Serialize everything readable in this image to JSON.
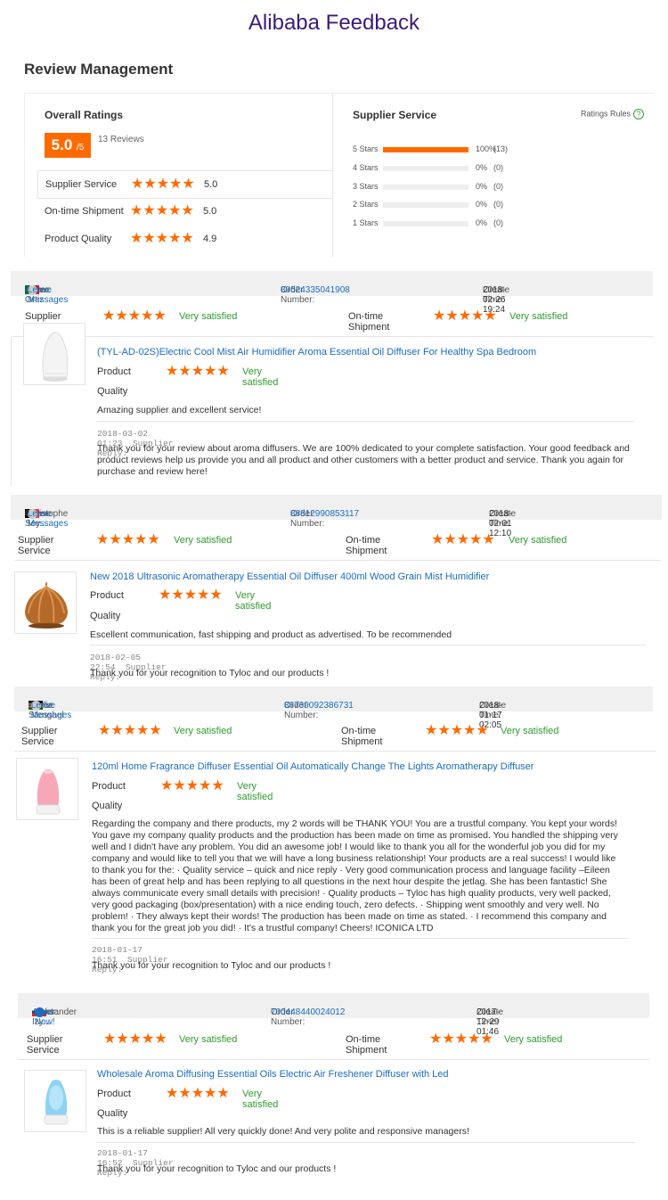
{
  "page": {
    "title": "Alibaba Feedback",
    "section_title": "Review Management"
  },
  "summary": {
    "overall_label": "Overall Ratings",
    "score": "5.0",
    "score_suffix": "/5",
    "reviews_count": "13 Reviews",
    "sub_ratings": [
      {
        "label": "Supplier Service",
        "value": "5.0",
        "stars": 5
      },
      {
        "label": "On-time Shipment",
        "value": "5.0",
        "stars": 5
      },
      {
        "label": "Product Quality",
        "value": "4.9",
        "stars": 5
      }
    ],
    "supplier_service_label": "Supplier Service",
    "rules_label": "Ratings Rules",
    "distribution": [
      {
        "label": "5 Stars",
        "fraction": 1.0,
        "pct": "100%",
        "count": "(13)"
      },
      {
        "label": "4 Stars",
        "fraction": 0,
        "pct": "0%",
        "count": "(0)"
      },
      {
        "label": "3 Stars",
        "fraction": 0,
        "pct": "0%",
        "count": "(0)"
      },
      {
        "label": "2 Stars",
        "fraction": 0,
        "pct": "0%",
        "count": "(0)"
      },
      {
        "label": "1 Stars",
        "fraction": 0,
        "pct": "0%",
        "count": "(0)"
      }
    ]
  },
  "labels": {
    "buyer": "Buyer:",
    "order_number": "Order Number:",
    "create_time": "Create Time:",
    "supplier_service": "Supplier Service",
    "on_time_shipment": "On-time Shipment",
    "product": "Product",
    "quality": "Quality",
    "supplier_reply": "Supplier Reply:",
    "very_satisfied": "Very satisfied"
  },
  "reviews": [
    {
      "buyer": "Arturo Ortiz",
      "action": "Leave Messages",
      "order_number": "89524335041908",
      "create_time": "2018-02-26 19:24",
      "product_title": "(TYL-AD-02S)Electric Cool Mist Air Humidifier Aroma Essential Oil Diffuser For Healthy Spa Bedroom",
      "comment": "Amazing supplier and excellent service!",
      "reply_time": "2018-03-02 01:23",
      "reply": "Thank you for your review about aroma diffusers. We are 100% dedicated to your complete satisfaction. Your good feedback and product reviews help us provide you and all product and other customers with a better product and service. Thank you again for purchase and review here!"
    },
    {
      "buyer": "Christophe Sey...",
      "action": "Leave Messages",
      "order_number": "88812990853117",
      "create_time": "2018-02-01 12:10",
      "product_title": "New 2018 Ultrasonic Aromatherapy Essential Oil Diffuser 400ml Wood Grain Mist Humidifier",
      "comment": "Escellent communication, fast shipping and product as advertised. To be recommended",
      "reply_time": "2018-02-05 22:54",
      "reply": "Thank you for your recognition to Tyloc and our products !"
    },
    {
      "buyer": "Emilia Stenghel",
      "action": "Leave Messages",
      "order_number": "86739092386731",
      "create_time": "2018-01-17 02:05",
      "product_title": "120ml Home Fragrance Diffuser Essential Oil Automatically Change The Lights Aromatherapy Diffuser",
      "comment": "Regarding the company and there products, my 2 words will be THANK YOU! You are a trustful company. You kept your words! You gave my company quality products and the production has been made on time as promised. You handled the shipping very well and I didn't have any problem. You did an awesome job! I would like to thank you all for the wonderful job you did for my company and would like to tell you that we will have a long business relationship! Your products are a real success! I would like to thank you for the: · Quality service – quick and nice reply · Very good communication process and language facility –Eileen has been of great help and has been replying to all questions in the next hour despite the jetlag. She has been fantastic! She always communicate every small details with precision! · Quality products – Tyloc has high quality products, very well packed, very good packaging (box/presentation) with a nice ending touch, zero defects. · Shipping went smoothly and very well. No problem! · They always kept their words! The production has been made on time as stated. · I recommend this company and thank you for the great job you did! · It's a trustful company! Cheers! ICONICA LTD",
      "reply_time": "2018-01-17 16:51",
      "reply": "Thank you for your recognition to Tyloc and our products !"
    },
    {
      "buyer": "Aleksander Izy...",
      "action": "Chat Now!",
      "order_number": "700448440024012",
      "create_time": "2017-12-29 01:46",
      "product_title": "Wholesale Aroma Diffusing Essential Oils Electric Air Freshener Diffuser with Led",
      "comment": "This is a reliable supplier! All very quickly done! And very polite and responsive managers!",
      "reply_time": "2018-01-17 16:52",
      "reply": "Thank you for your recognition to Tyloc and our products !"
    }
  ],
  "colors": {
    "accent": "#ff6a00",
    "link": "#1a6dbf",
    "satisfied": "#2e9b2e",
    "title": "#3d1a78"
  }
}
